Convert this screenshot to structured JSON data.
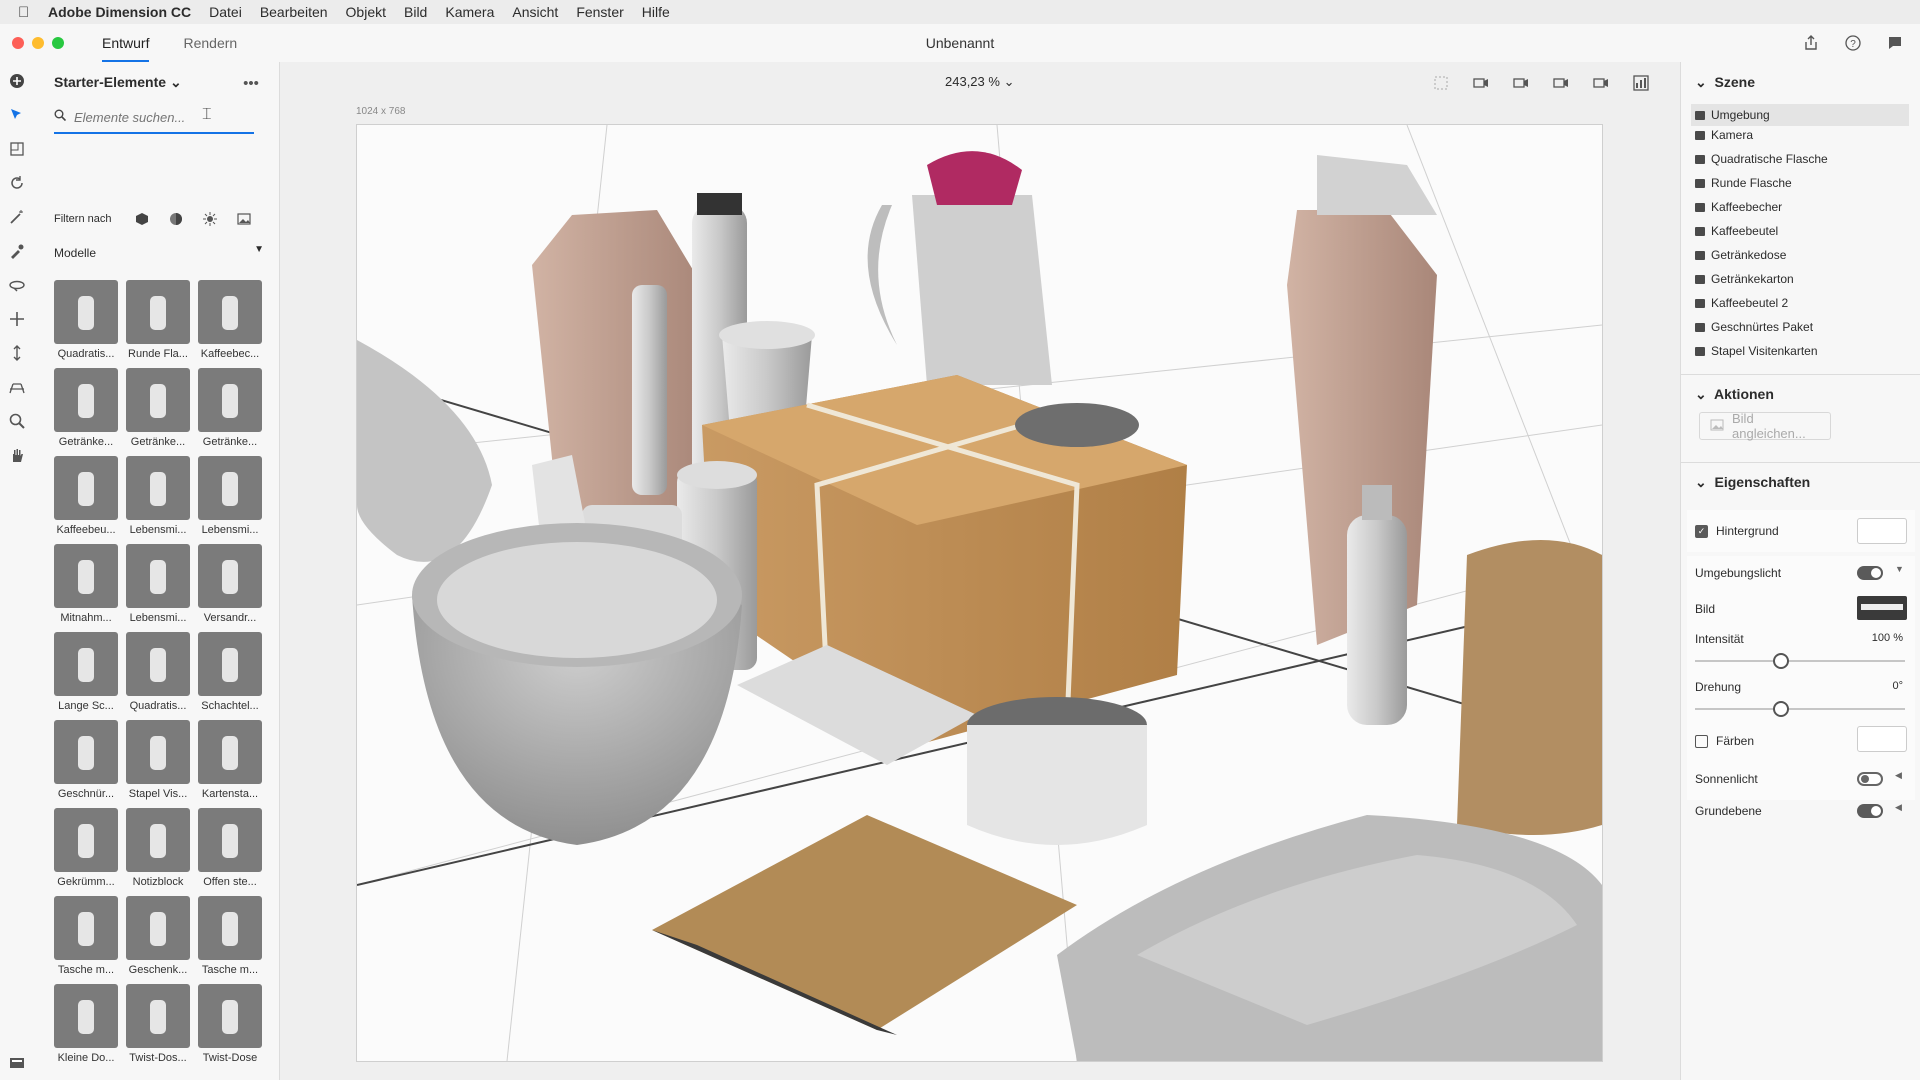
{
  "menubar": {
    "app_name": "Adobe Dimension CC",
    "items": [
      "Datei",
      "Bearbeiten",
      "Objekt",
      "Bild",
      "Kamera",
      "Ansicht",
      "Fenster",
      "Hilfe"
    ]
  },
  "titlebar": {
    "tabs": [
      "Entwurf",
      "Rendern"
    ],
    "document_title": "Unbenannt"
  },
  "assets": {
    "header": "Starter-Elemente",
    "search_placeholder": "Elemente suchen...",
    "filter_label": "Filtern nach",
    "section_label": "Modelle",
    "items": [
      "Quadratis...",
      "Runde Fla...",
      "Kaffeebec...",
      "Getränke...",
      "Getränke...",
      "Getränke...",
      "Kaffeebeu...",
      "Lebensmi...",
      "Lebensmi...",
      "Mitnahm...",
      "Lebensmi...",
      "Versandr...",
      "Lange Sc...",
      "Quadratis...",
      "Schachtel...",
      "Geschnür...",
      "Stapel Vis...",
      "Kartensta...",
      "Gekrümm...",
      "Notizblock",
      "Offen ste...",
      "Tasche m...",
      "Geschenk...",
      "Tasche m...",
      "Kleine Do...",
      "Twist-Dos...",
      "Twist-Dose"
    ]
  },
  "viewport": {
    "zoom": "243,23 %",
    "canvas_size": "1024 x 768"
  },
  "scene": {
    "title": "Szene",
    "items": [
      "Umgebung",
      "Kamera",
      "Quadratische Flasche",
      "Runde Flasche",
      "Kaffeebecher",
      "Kaffeebeutel",
      "Getränkedose",
      "Getränkekarton",
      "Kaffeebeutel 2",
      "Geschnürtes Paket",
      "Stapel Visitenkarten"
    ]
  },
  "actions": {
    "title": "Aktionen",
    "match_image": "Bild angleichen..."
  },
  "properties": {
    "title": "Eigenschaften",
    "background": "Hintergrund",
    "environment_light": "Umgebungslicht",
    "image": "Bild",
    "intensity": "Intensität",
    "intensity_value": "100 %",
    "intensity_fraction": 0.4,
    "rotation": "Drehung",
    "rotation_value": "0°",
    "rotation_fraction": 0.4,
    "colorize": "Färben",
    "sunlight": "Sonnenlicht",
    "ground_plane": "Grundebene"
  },
  "colors": {
    "accent": "#1473e6",
    "thumb_bg": "#7b7b7b"
  }
}
